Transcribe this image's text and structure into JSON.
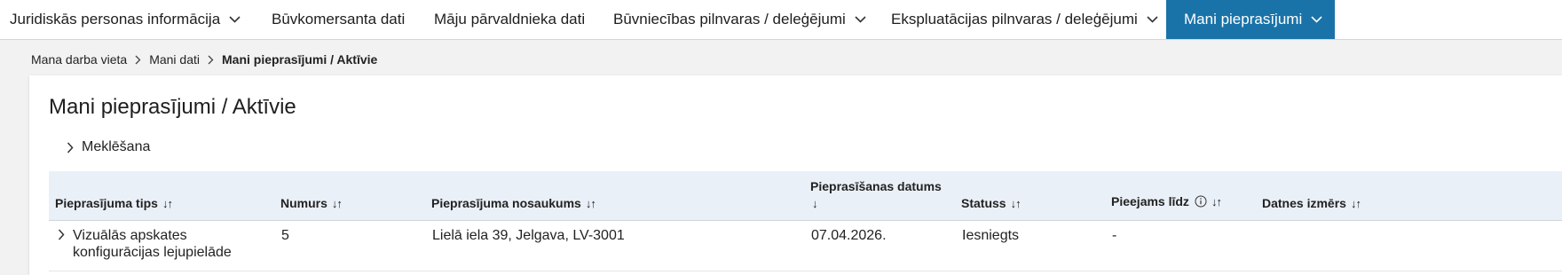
{
  "nav": {
    "items": [
      {
        "label": "Juridiskās personas informācija",
        "has_dropdown": true
      },
      {
        "label": "Būvkomersanta dati",
        "has_dropdown": false
      },
      {
        "label": "Māju pārvaldnieka dati",
        "has_dropdown": false
      },
      {
        "label": "Būvniecības pilnvaras / deleģējumi",
        "has_dropdown": true
      },
      {
        "label": "Ekspluatācijas pilnvaras / deleģējumi",
        "has_dropdown": true
      },
      {
        "label": "Mani pieprasījumi",
        "has_dropdown": true,
        "active": true
      }
    ]
  },
  "breadcrumb": {
    "items": [
      "Mana darba vieta",
      "Mani dati"
    ],
    "current": "Mani pieprasījumi / Aktīvie"
  },
  "page": {
    "title": "Mani pieprasījumi / Aktīvie",
    "search_toggle": "Meklēšana"
  },
  "table": {
    "sort_symbol": "↓↑",
    "sort_desc_symbol": "↓",
    "columns": {
      "type": "Pieprasījuma tips",
      "number": "Numurs",
      "name": "Pieprasījuma nosaukums",
      "date": "Pieprasīšanas datums",
      "status": "Statuss",
      "available": "Pieejams līdz",
      "size": "Datnes izmērs"
    },
    "rows": [
      {
        "type_line1": "Vizuālās apskates",
        "type_line2": "konfigurācijas lejupielāde",
        "number": "5",
        "name": "Lielā iela 39, Jelgava, LV-3001",
        "date": "07.04.2026.",
        "status": "Iesniegts",
        "available": "-",
        "size": ""
      }
    ]
  },
  "colors": {
    "accent": "#1a73a8",
    "header_bg": "#eaf0f7",
    "page_bg": "#f2f2f2"
  }
}
